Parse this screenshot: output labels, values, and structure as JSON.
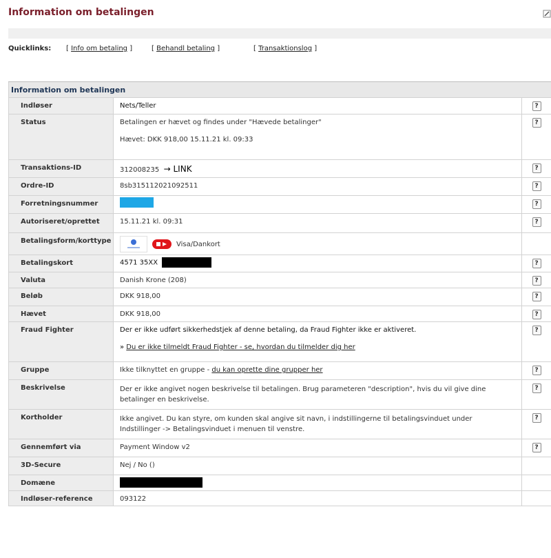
{
  "page": {
    "title": "Information om betalingen"
  },
  "quicklinks": {
    "label": "Quicklinks:",
    "items": [
      {
        "pre": "[ ",
        "text": "Info om betaling",
        "post": " ]"
      },
      {
        "pre": "[ ",
        "text": "Behandl betaling",
        "post": " ]"
      },
      {
        "pre": "[ ",
        "text": "Transaktionslog",
        "post": " ]"
      }
    ]
  },
  "table": {
    "header": "Information om betalingen",
    "help_glyph": "?",
    "rows": {
      "indloser": {
        "label": "Indløser",
        "value": "Nets/Teller"
      },
      "status": {
        "label": "Status",
        "value": "Betalingen er hævet og findes under \"Hævede betalinger\"",
        "sub": "Hævet:  DKK 918,00  15.11.21  kl. 09:33"
      },
      "transaktion": {
        "label": "Transaktions-ID",
        "value": "312008235",
        "arrow": "→ LINK"
      },
      "ordre": {
        "label": "Ordre-ID",
        "value": "8sb315112021092511"
      },
      "forretning": {
        "label": "Forretningsnummer",
        "value": ""
      },
      "autoriseret": {
        "label": "Autoriseret/oprettet",
        "value": "15.11.21  kl. 09:31"
      },
      "betalingsform": {
        "label": "Betalingsform/korttype",
        "value": "Visa/Dankort"
      },
      "betalingskort": {
        "label": "Betalingskort",
        "value": "4571 35XX"
      },
      "valuta": {
        "label": "Valuta",
        "value": "Danish Krone (208)"
      },
      "belob": {
        "label": "Beløb",
        "value": "DKK 918,00"
      },
      "haevet": {
        "label": "Hævet",
        "value": "DKK 918,00"
      },
      "fraud": {
        "label": "Fraud Fighter",
        "value": "Der er ikke udført sikkerhedstjek af denne betaling, da Fraud Fighter ikke er aktiveret.",
        "sub_prefix": "» ",
        "sub_link": "Du er ikke tilmeldt Fraud Fighter - se, hvordan du tilmelder dig her"
      },
      "gruppe": {
        "label": "Gruppe",
        "value": "Ikke tilknyttet en gruppe - ",
        "link": "du kan oprette dine grupper her"
      },
      "beskrivelse": {
        "label": "Beskrivelse",
        "value": "Der er ikke angivet nogen beskrivelse til betalingen. Brug parameteren \"description\", hvis du vil give dine betalinger en beskrivelse."
      },
      "kortholder": {
        "label": "Kortholder",
        "value": "Ikke angivet. Du kan styre, om kunden skal angive sit navn, i indstillingerne til betalingsvinduet under Indstillinger -> Betalingsvinduet i menuen til venstre."
      },
      "gennemfort": {
        "label": "Gennemført via",
        "value": "Payment Window v2"
      },
      "secure": {
        "label": "3D-Secure",
        "value": "Nej / No ()"
      },
      "domaene": {
        "label": "Domæne",
        "value": ""
      },
      "reference": {
        "label": "Indløser-reference",
        "value": "093122"
      }
    }
  }
}
